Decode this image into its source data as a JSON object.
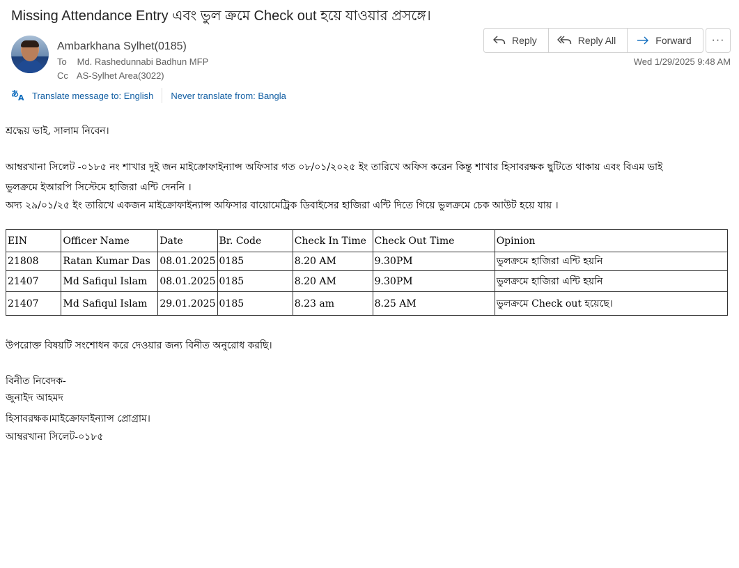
{
  "email": {
    "subject": "Missing Attendance Entry  এবং ভুল ক্রমে Check out হয়ে যাওয়ার প্রসঙ্গে।",
    "sender": "Ambarkhana Sylhet(0185)",
    "to_label": "To",
    "to_value": "Md. Rashedunnabi Badhun MFP",
    "cc_label": "Cc",
    "cc_value": "AS-Sylhet Area(3022)",
    "date": "Wed 1/29/2025 9:48 AM"
  },
  "actions": {
    "reply": "Reply",
    "reply_all": "Reply All",
    "forward": "Forward",
    "more": "···"
  },
  "translate": {
    "translate_label": "Translate message to: English",
    "never_label": "Never translate from: Bangla"
  },
  "body": {
    "greeting": "শ্রদ্ধেয় ভাই, সালাম নিবেন।",
    "para1_line1": "আম্বরখানা সিলেট -০১৮৫ নং  শাখার দুই জন মাইক্রোফাইন্যান্স অফিসার গত ০৮/০১/২০২৫ ইং তারিখে অফিস করেন কিন্তু শাখার হিসাবরক্ষক  ছুটিতে থাকায় এবং বিএম ভাই",
    "para1_line2": "ভুলক্রমে ইআরপি সিস্টেমে হাজিরা এন্টি দেননি ।",
    "para1_line3": "অদ্য ২৯/০১/২৫ ইং তারিখে একজন মাইক্রোফাইন্যান্স অফিসার বায়োমেট্রিক ডিবাইসের হাজিরা এন্টি দিতে গিয়ে ভুলক্রমে চেক আউট হয়ে যায় ।",
    "request": "উপরোক্ত বিষয়টি সংশোধন করে দেওয়ার জন্য বিনীত অনুরোধ করছি।",
    "sign_1": "বিনীত নিবেদক-",
    "sign_2": "জুনাইদ আহমদ",
    "sign_3": "হিসাবরক্ষক।মাইক্রোফাইন্যান্স প্রোগ্রাম।",
    "sign_4": "আম্বরখানা সিলেট-০১৮৫"
  },
  "table": {
    "headers": [
      "EIN",
      "Officer Name",
      "Date",
      "Br. Code",
      "Check In Time",
      "Check Out Time",
      "Opinion"
    ],
    "rows": [
      [
        "21808",
        "Ratan Kumar Das",
        "08.01.2025",
        "0185",
        "8.20 AM",
        "9.30PM",
        "ভুলক্রমে হাজিরা এন্টি হয়নি"
      ],
      [
        "21407",
        "Md Safiqul Islam",
        "08.01.2025",
        "0185",
        "8.20 AM",
        "9.30PM",
        "ভুলক্রমে হাজিরা এন্টি হয়নি"
      ],
      [
        "21407",
        "Md Safiqul Islam",
        "29.01.2025",
        "0185",
        "8.23 am",
        "8.25 AM",
        "ভুলক্রমে Check out হয়েছে।"
      ]
    ]
  },
  "colors": {
    "link": "#115ea3",
    "text": "#242424",
    "muted": "#616161",
    "border": "#d1d1d1"
  }
}
